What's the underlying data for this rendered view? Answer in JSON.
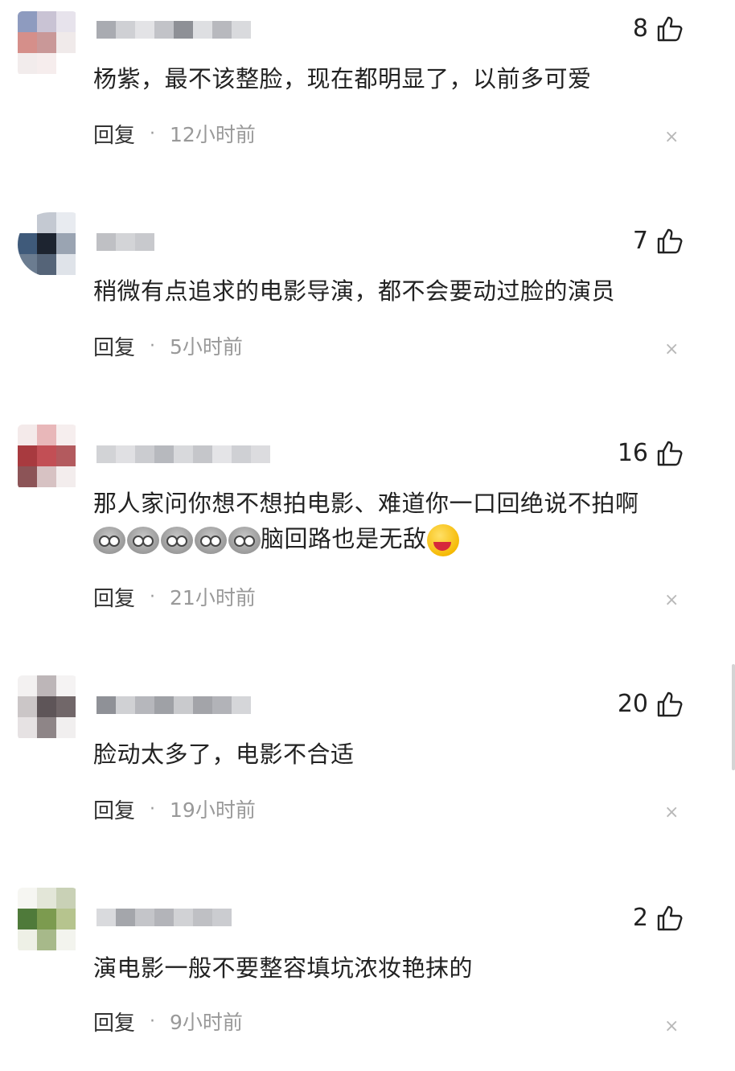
{
  "comments": [
    {
      "likes": "8",
      "text": "杨紫，最不该整脸，现在都明显了，以前多可爱",
      "reply_label": "回复",
      "time": "12小时前"
    },
    {
      "likes": "7",
      "text": "稍微有点追求的电影导演，都不会要动过脸的演员",
      "reply_label": "回复",
      "time": "5小时前"
    },
    {
      "likes": "16",
      "text_line1": "那人家问你想不想拍电影、难道你一口回绝说不拍啊",
      "text_line2": "脑回路也是无敌",
      "reply_label": "回复",
      "time": "21小时前"
    },
    {
      "likes": "20",
      "text": "脸动太多了，电影不合适",
      "reply_label": "回复",
      "time": "19小时前"
    },
    {
      "likes": "2",
      "text": "演电影一般不要整容填坑浓妆艳抹的",
      "reply_label": "回复",
      "time": "9小时前"
    }
  ],
  "dot_separator": "·",
  "close_glyph": "×",
  "icons": {
    "like": "thumbs-up-icon",
    "close": "close-icon",
    "skull": "skull-emoji-icon",
    "laugh": "laughing-crying-emoji-icon"
  },
  "colors": {
    "text": "#222222",
    "meta": "#999999",
    "close": "#b8b8b8"
  }
}
